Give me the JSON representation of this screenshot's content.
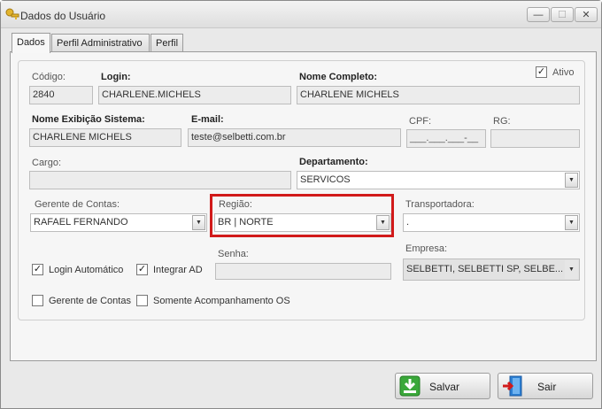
{
  "window": {
    "title": "Dados do Usuário",
    "minimize_label": "—",
    "maximize_label": "☐",
    "close_label": "✕"
  },
  "tabs": [
    {
      "label": "Dados"
    },
    {
      "label": "Perfil Administrativo"
    },
    {
      "label": "Perfil"
    }
  ],
  "form": {
    "codigo": {
      "label": "Código:",
      "value": "2840"
    },
    "login": {
      "label": "Login:",
      "value": "CHARLENE.MICHELS"
    },
    "nome_completo": {
      "label": "Nome Completo:",
      "value": "CHARLENE MICHELS"
    },
    "ativo": {
      "label": "Ativo",
      "checked": true
    },
    "nome_exibicao": {
      "label": "Nome Exibição Sistema:",
      "value": "CHARLENE MICHELS"
    },
    "email": {
      "label": "E-mail:",
      "value": "teste@selbetti.com.br"
    },
    "cpf": {
      "label": "CPF:",
      "value": "___.___.___-__"
    },
    "rg": {
      "label": "RG:",
      "value": ""
    },
    "cargo": {
      "label": "Cargo:",
      "value": ""
    },
    "departamento": {
      "label": "Departamento:",
      "value": "SERVICOS"
    },
    "gerente": {
      "label": "Gerente de Contas:",
      "value": "RAFAEL FERNANDO"
    },
    "regiao": {
      "label": "Região:",
      "value": "BR |  NORTE"
    },
    "transportadora": {
      "label": "Transportadora:",
      "value": "."
    },
    "login_automatico": {
      "label": "Login Automático",
      "checked": true
    },
    "integrar_ad": {
      "label": "Integrar AD",
      "checked": true
    },
    "senha": {
      "label": "Senha:",
      "value": ""
    },
    "empresa": {
      "label": "Empresa:",
      "value": "SELBETTI,  SELBETTI SP,  SELBE..."
    },
    "gerente_contas_chk": {
      "label": "Gerente de Contas",
      "checked": false
    },
    "somente_os": {
      "label": "Somente Acompanhamento OS",
      "checked": false
    }
  },
  "buttons": {
    "salvar": "Salvar",
    "sair": "Sair"
  },
  "colors": {
    "highlight": "#d11a1a",
    "salvar_icon": "#3aa83a",
    "sair_icon": "#2a7fd4"
  }
}
